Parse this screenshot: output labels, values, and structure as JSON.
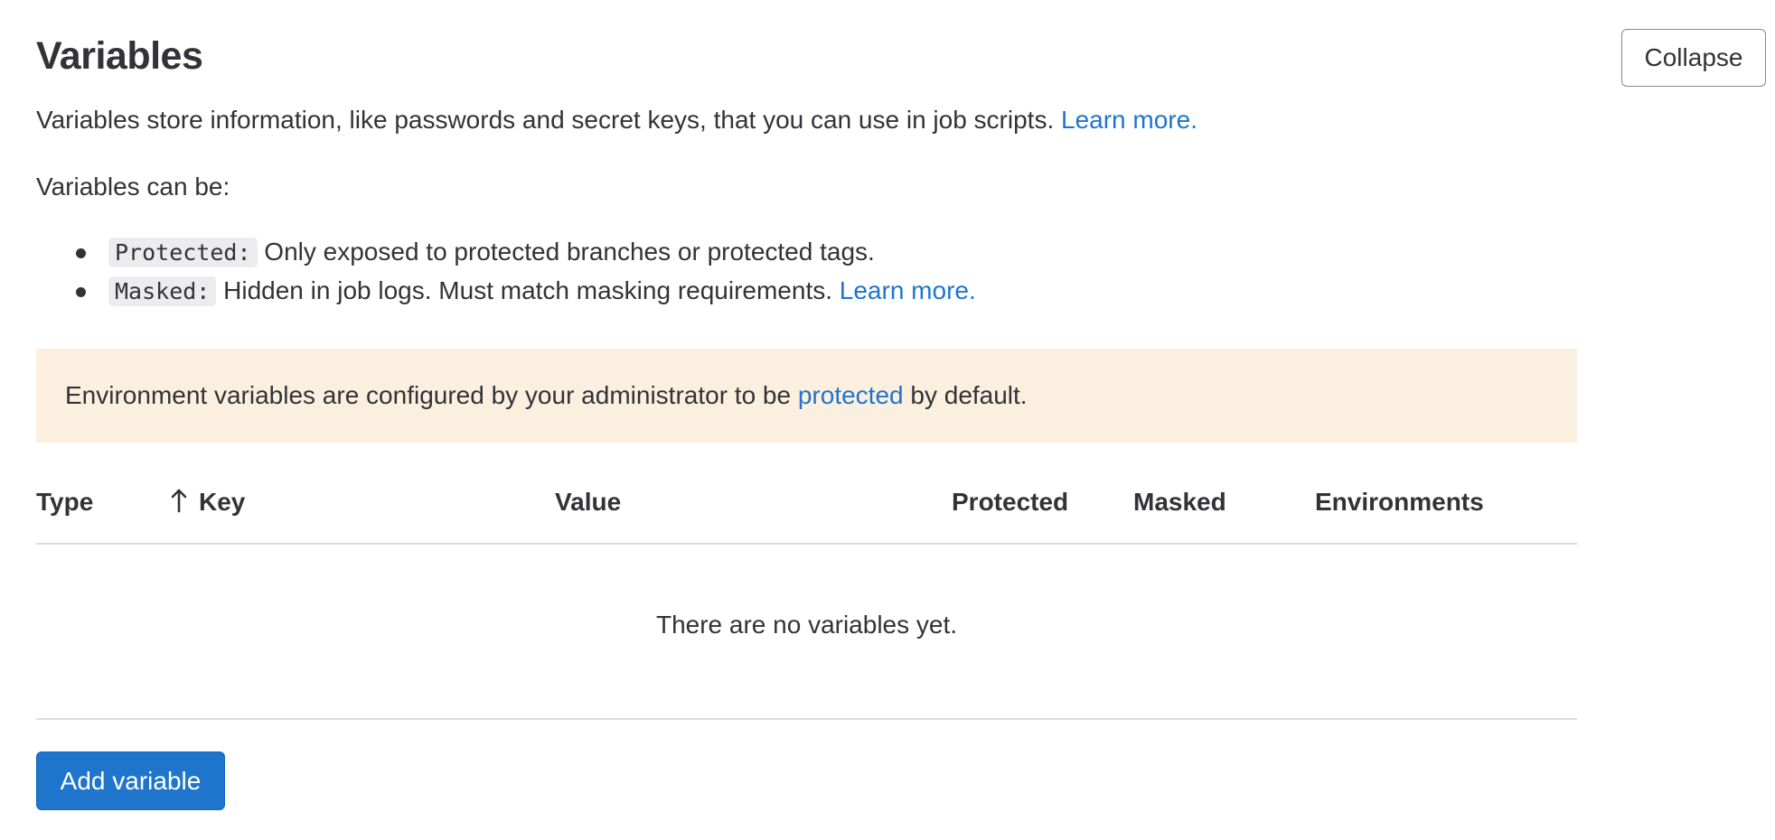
{
  "header": {
    "title": "Variables",
    "collapse_label": "Collapse"
  },
  "intro": {
    "description": "Variables store information, like passwords and secret keys, that you can use in job scripts.",
    "learn_more": "Learn more.",
    "can_be": "Variables can be:"
  },
  "rules": [
    {
      "code": "Protected:",
      "text": "Only exposed to protected branches or protected tags.",
      "link": ""
    },
    {
      "code": "Masked:",
      "text": "Hidden in job logs. Must match masking requirements.",
      "link": "Learn more."
    }
  ],
  "alert": {
    "before": "Environment variables are configured by your administrator to be",
    "link": "protected",
    "after": "by default.",
    "background": "#fbf0e0"
  },
  "table": {
    "columns": [
      "Type",
      "Key",
      "Value",
      "Protected",
      "Masked",
      "Environments"
    ],
    "sort_icon": "arrow-up-icon",
    "empty_text": "There are no variables yet."
  },
  "actions": {
    "add_variable": "Add variable"
  },
  "colors": {
    "link": "#1f75cb",
    "primary_button": "#1f75cb",
    "text": "#333238"
  }
}
